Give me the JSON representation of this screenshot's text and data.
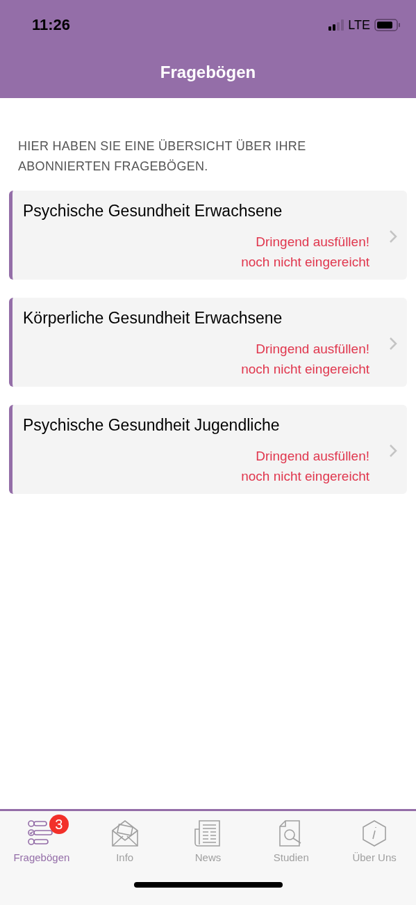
{
  "status_bar": {
    "time": "11:26",
    "network": "LTE"
  },
  "nav": {
    "title": "Fragebögen"
  },
  "intro": "HIER HABEN SIE EINE ÜBERSICHT ÜBER IHRE ABONNIERTEN FRAGEBÖGEN.",
  "questionnaires": [
    {
      "title": "Psychische Gesundheit Erwachsene",
      "status": "Dringend ausfüllen!",
      "submission": "noch nicht eingereicht"
    },
    {
      "title": "Körperliche Gesundheit Erwachsene",
      "status": "Dringend ausfüllen!",
      "submission": "noch nicht eingereicht"
    },
    {
      "title": "Psychische Gesundheit Jugendliche",
      "status": "Dringend ausfüllen!",
      "submission": "noch nicht eingereicht"
    }
  ],
  "tabs": [
    {
      "kind": "checklist",
      "label": "Fragebögen",
      "selected": true,
      "badge": "3"
    },
    {
      "kind": "envelope",
      "label": "Info",
      "selected": false
    },
    {
      "kind": "newspaper",
      "label": "News",
      "selected": false
    },
    {
      "kind": "document",
      "label": "Studien",
      "selected": false
    },
    {
      "kind": "info",
      "label": "Über Uns",
      "selected": false
    }
  ]
}
